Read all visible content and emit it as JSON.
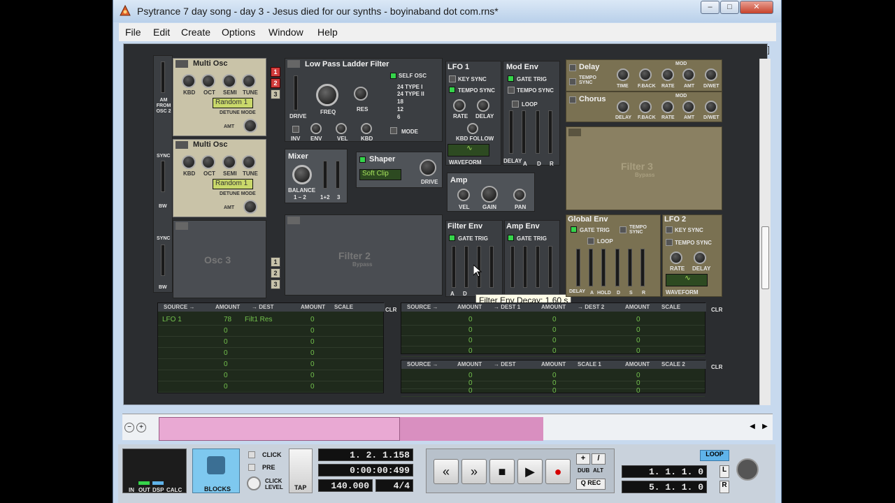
{
  "window": {
    "title": "Psytrance 7 day song - day 3 - Jesus died for our synths - boyinaband dot com.rns*",
    "min_label": "–",
    "max_label": "□",
    "close_label": "✕"
  },
  "menu": [
    "File",
    "Edit",
    "Create",
    "Options",
    "Window",
    "Help"
  ],
  "osc1": {
    "title": "Multi Osc",
    "knobs": [
      "KBD",
      "OCT",
      "SEMI",
      "TUNE"
    ],
    "mode": "Random 1",
    "detune_mode": "DETUNE MODE",
    "amt": "AMT"
  },
  "osc2": {
    "title": "Multi Osc",
    "knobs": [
      "KBD",
      "OCT",
      "SEMI",
      "TUNE"
    ],
    "mode": "Random 1",
    "detune_mode": "DETUNE MODE",
    "amt": "AMT"
  },
  "osc3": {
    "title": "Osc 3"
  },
  "osc_side": {
    "am_from": "AM FROM OSC 2",
    "sync1": "SYNC",
    "bw1": "BW",
    "sync2": "SYNC",
    "bw2": "BW"
  },
  "filter1": {
    "title": "Low Pass Ladder Filter",
    "self_osc": "SELF OSC",
    "types": [
      "24 TYPE I",
      "24 TYPE II",
      "18",
      "12",
      "6"
    ],
    "freq": "FREQ",
    "res": "RES",
    "drive": "DRIVE",
    "inv": "INV",
    "env": "ENV",
    "vel": "VEL",
    "kbd": "KBD",
    "mode": "MODE",
    "routing": [
      "1",
      "2",
      "3"
    ]
  },
  "filter2": {
    "title": "Filter 2",
    "sub": "Bypass"
  },
  "filter3": {
    "title": "Filter 3",
    "sub": "Bypass"
  },
  "mixer": {
    "title": "Mixer",
    "balance": "BALANCE",
    "b1": "1 – 2",
    "b2": "1+2",
    "b3": "3"
  },
  "shaper": {
    "title": "Shaper",
    "mode": "Soft Clip",
    "drive": "DRIVE"
  },
  "amp": {
    "title": "Amp",
    "vel": "VEL",
    "gain": "GAIN",
    "pan": "PAN"
  },
  "lfo1": {
    "title": "LFO 1",
    "key_sync": "KEY SYNC",
    "tempo_sync": "TEMPO SYNC",
    "rate": "RATE",
    "delay": "DELAY",
    "kbd_follow": "KBD FOLLOW",
    "waveform": "WAVEFORM"
  },
  "mod_env": {
    "title": "Mod Env",
    "gate_trig": "GATE TRIG",
    "tempo_sync": "TEMPO SYNC",
    "loop": "LOOP",
    "faders": [
      "DELAY",
      "A",
      "D",
      "R"
    ]
  },
  "filter_env": {
    "title": "Filter Env",
    "gate_trig": "GATE TRIG",
    "faders": [
      "A",
      "D"
    ]
  },
  "amp_env": {
    "title": "Amp Env",
    "gate_trig": "GATE TRIG"
  },
  "delay": {
    "title": "Delay",
    "tempo_sync": "TEMPO SYNC",
    "mod": "MOD",
    "knobs": [
      "TIME",
      "F.BACK",
      "RATE",
      "AMT",
      "D/WET"
    ]
  },
  "chorus": {
    "title": "Chorus",
    "mod": "MOD",
    "knobs": [
      "DELAY",
      "F.BACK",
      "RATE",
      "AMT",
      "D/WET"
    ]
  },
  "global_env": {
    "title": "Global Env",
    "gate_trig": "GATE TRIG",
    "tempo_sync": "TEMPO SYNC",
    "loop": "LOOP",
    "faders": [
      "DELAY",
      "A",
      "HOLD",
      "D",
      "S",
      "R"
    ]
  },
  "lfo2": {
    "title": "LFO 2",
    "key_sync": "KEY SYNC",
    "tempo_sync": "TEMPO SYNC",
    "rate": "RATE",
    "delay": "DELAY",
    "waveform": "WAVEFORM"
  },
  "tooltip": "Filter Env Decay: 1.60 s",
  "matrix_left": {
    "headers": [
      "SOURCE →",
      "AMOUNT",
      "→ DEST",
      "AMOUNT",
      "SCALE"
    ],
    "clr": "CLR",
    "rows": [
      {
        "source": "LFO 1",
        "amount": "78",
        "dest": "Filt1 Res",
        "amount2": "0"
      },
      {
        "source": "",
        "amount": "0",
        "dest": "",
        "amount2": "0"
      },
      {
        "source": "",
        "amount": "0",
        "dest": "",
        "amount2": "0"
      },
      {
        "source": "",
        "amount": "0",
        "dest": "",
        "amount2": "0"
      },
      {
        "source": "",
        "amount": "0",
        "dest": "",
        "amount2": "0"
      },
      {
        "source": "",
        "amount": "0",
        "dest": "",
        "amount2": "0"
      },
      {
        "source": "",
        "amount": "0",
        "dest": "",
        "amount2": "0"
      }
    ]
  },
  "matrix_right_top": {
    "headers": [
      "SOURCE →",
      "AMOUNT",
      "→ DEST 1",
      "AMOUNT",
      "→ DEST 2",
      "AMOUNT",
      "SCALE"
    ],
    "clr": "CLR",
    "rows": [
      {
        "a": "0",
        "b": "0",
        "c": "0"
      },
      {
        "a": "0",
        "b": "0",
        "c": "0"
      },
      {
        "a": "0",
        "b": "0",
        "c": "0"
      },
      {
        "a": "0",
        "b": "0",
        "c": "0"
      }
    ]
  },
  "matrix_right_bottom": {
    "headers": [
      "SOURCE →",
      "AMOUNT",
      "→ DEST",
      "AMOUNT",
      "SCALE 1",
      "AMOUNT",
      "SCALE 2"
    ],
    "clr": "CLR",
    "rows": [
      {
        "a": "0",
        "b": "0",
        "c": "0"
      },
      {
        "a": "0",
        "b": "0",
        "c": "0"
      },
      {
        "a": "0",
        "b": "0",
        "c": "0"
      }
    ]
  },
  "transport": {
    "in": "IN",
    "out": "OUT",
    "dsp": "DSP",
    "calc": "CALC",
    "blocks": "BLOCKS",
    "click": "CLICK",
    "pre": "PRE",
    "click_level": "CLICK LEVEL",
    "tap": "TAP",
    "position": "1. 2. 1.158",
    "time": "0:00:00:499",
    "tempo": "140.000",
    "signature": "4/4",
    "dub": "DUB",
    "alt": "ALT",
    "q_rec": "Q REC",
    "loop": "LOOP",
    "loop_start": "1. 1. 1.   0",
    "loop_end": "5. 1. 1.   0",
    "l": "L",
    "r": "R",
    "plus": "+",
    "slash": "/"
  },
  "colors": {
    "accent_green": "#35d44a",
    "lcd_green": "#a6e35c",
    "record_red": "#d60000",
    "blocks_blue": "#7ec8ef",
    "loop_blue": "#5fb3ea"
  }
}
